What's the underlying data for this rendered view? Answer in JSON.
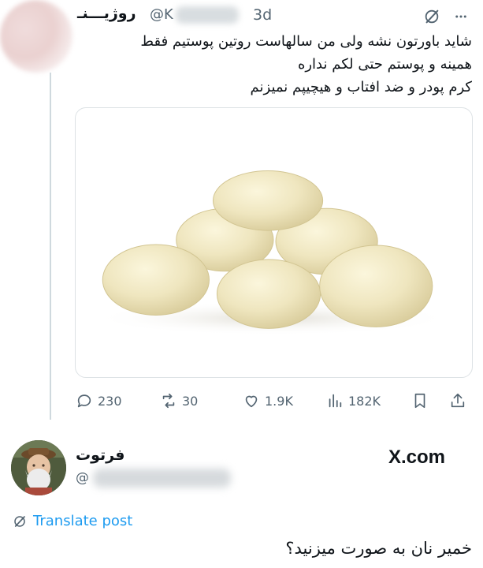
{
  "tweet": {
    "author_name": "روژیـــنـ",
    "handle_prefix": "@K",
    "time": "3d",
    "icons": {
      "grok": "grok-icon",
      "more": "more-icon"
    },
    "body_lines": [
      "شاید باورتون نشه ولی من سالهاست روتین پوستیم فقط",
      "همینه و پوستم حتی لکم نداره",
      "کرم پودر و ضد افتاب و هیچیپم نمیزنم"
    ],
    "image": {
      "subject": "dough-balls-photo"
    }
  },
  "actions": {
    "replies": "230",
    "reposts": "30",
    "likes": "1.9K",
    "views": "182K",
    "icons": [
      "reply-icon",
      "repost-icon",
      "like-icon",
      "views-icon",
      "bookmark-icon",
      "share-icon"
    ]
  },
  "quote": {
    "author_name": "فرتوت",
    "handle_prefix": "@",
    "brand": "X.com",
    "translate_label": "Translate post",
    "text": "خمیر نان به صورت میزنید؟"
  },
  "colors": {
    "text": "#0f1419",
    "secondary": "#536471",
    "link": "#1d9bf0",
    "border": "#dde2e5"
  }
}
